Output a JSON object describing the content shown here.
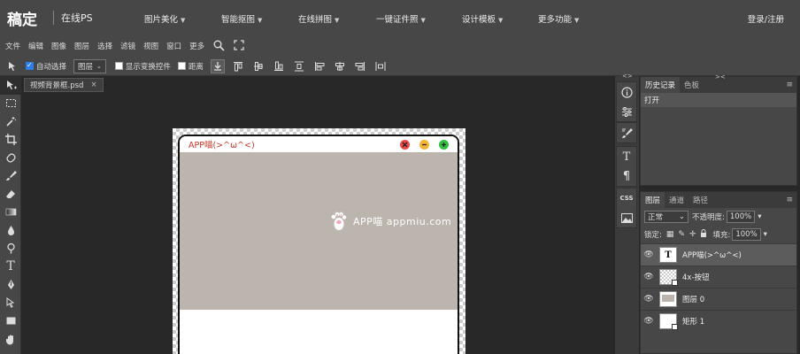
{
  "topnav": {
    "logo": "稿定",
    "brand": "在线PS",
    "items": [
      {
        "label": "图片美化"
      },
      {
        "label": "智能抠图"
      },
      {
        "label": "在线拼图"
      },
      {
        "label": "一键证件照"
      },
      {
        "label": "设计模板"
      },
      {
        "label": "更多功能"
      }
    ],
    "login": "登录/注册"
  },
  "menubar": {
    "items": [
      "文件",
      "编辑",
      "图像",
      "图层",
      "选择",
      "滤镜",
      "视图",
      "窗口",
      "更多"
    ]
  },
  "options": {
    "auto_select": {
      "label": "自动选择",
      "checked": true
    },
    "select_target": "图层",
    "show_transform": {
      "label": "显示变换控件",
      "checked": false
    },
    "distance": {
      "label": "距离",
      "checked": false
    }
  },
  "document": {
    "tab_name": "视频背景框.psd",
    "close": "×"
  },
  "canvas": {
    "window_title": "APP喵(>^ω^<)",
    "watermark": "APP喵  appmiu.com",
    "colors": {
      "bg": "#bcb5ae",
      "close": "#ee4a4a",
      "min": "#f6b333",
      "max": "#30c03d",
      "title": "#c0392b"
    }
  },
  "history_panel": {
    "tabs": [
      "历史记录",
      "色板"
    ],
    "entries": [
      "打开"
    ]
  },
  "layers_panel": {
    "tabs": [
      "图层",
      "通道",
      "路径"
    ],
    "blend_mode": "正常",
    "opacity_label": "不透明度:",
    "opacity": "100%",
    "lock_label": "锁定:",
    "fill_label": "填充:",
    "fill": "100%",
    "layers": [
      {
        "name": "APP喵(>^ω^<)",
        "thumb": "text",
        "thumb_char": "T"
      },
      {
        "name": "4x-按钮",
        "thumb": "check"
      },
      {
        "name": "图层 0",
        "thumb": "gray"
      },
      {
        "name": "矩形 1",
        "thumb": "white"
      }
    ]
  },
  "right_strip": {
    "css_label": "CSS"
  }
}
